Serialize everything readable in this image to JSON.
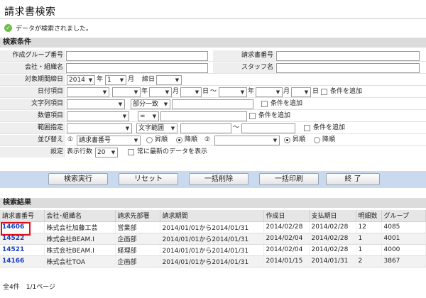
{
  "page": {
    "title": "請求書検索"
  },
  "message": {
    "text": "データが検索されました。"
  },
  "search": {
    "header": "検索条件",
    "labels": {
      "group_no": "作成グループ番号",
      "invoice_no": "請求書番号",
      "company": "会社・組織名",
      "staff": "スタッフ名",
      "period": "対象期間締日",
      "date_item": "日付項目",
      "string_item": "文字列項目",
      "numeric_item": "数値項目",
      "range": "範囲指定",
      "sort": "並び替え",
      "settings": "設定"
    },
    "period": {
      "year": "2014",
      "year_unit": "年",
      "month": "1",
      "month_unit": "月",
      "closing_label": "締日"
    },
    "date_units": {
      "y": "年",
      "m": "月",
      "d": "日",
      "tilde": "〜"
    },
    "add_condition": "条件を追加",
    "string_match": "部分一致",
    "numeric_op": "=",
    "range_type": "文字範囲",
    "range_tilde": "〜",
    "sort": {
      "num1": "①",
      "field1": "請求書番号",
      "asc": "昇順",
      "desc": "降順",
      "num2": "②"
    },
    "settings": {
      "rows_label": "表示行数",
      "rows_value": "20",
      "latest_label": "常に最新のデータを表示"
    }
  },
  "buttons": {
    "search": "検索実行",
    "reset": "リセット",
    "bulk_delete": "一括削除",
    "bulk_print": "一括印刷",
    "end": "終 了"
  },
  "results": {
    "header": "検索結果",
    "columns": [
      "請求書番号",
      "会社･組織名",
      "請求先部署",
      "請求期間",
      "作成日",
      "支払期日",
      "明細数",
      "グループ"
    ],
    "rows": [
      [
        "14606",
        "株式会社加藤工芸",
        "営業部",
        "2014/01/01から2014/01/31",
        "2014/02/28",
        "2014/02/28",
        "12",
        "4085"
      ],
      [
        "14522",
        "株式会社BEAM.I",
        "企画部",
        "2014/01/01から2014/01/31",
        "2014/02/04",
        "2014/02/28",
        "1",
        "4001"
      ],
      [
        "14521",
        "株式会社BEAM.I",
        "経理部",
        "2014/01/01から2014/01/31",
        "2014/02/04",
        "2014/02/28",
        "1",
        "4000"
      ],
      [
        "14166",
        "株式会社TOA",
        "企画部",
        "2014/01/01から2014/01/31",
        "2014/01/15",
        "2014/01/31",
        "2",
        "3867"
      ]
    ],
    "footer": "全4件　1/1ページ"
  },
  "colors": {
    "accent_bar": "#c9d9ee",
    "link": "#1a3fbf",
    "highlight": "#e0101a",
    "ok": "#6cc04a"
  }
}
